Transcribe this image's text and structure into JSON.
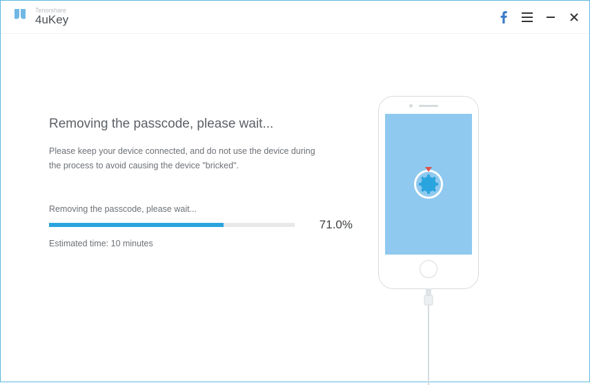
{
  "brand": {
    "company": "Tenorshare",
    "product": "4uKey"
  },
  "main": {
    "heading": "Removing the passcode, please wait...",
    "description": "Please keep your device connected, and do not use the device during the process to avoid causing the device \"bricked\"."
  },
  "progress": {
    "label": "Removing the passcode, please wait...",
    "percent_text": "71.0%",
    "percent_value": 71.0,
    "estimated_label": "Estimated time: 10 minutes"
  },
  "colors": {
    "accent": "#2aa4de",
    "window_border": "#5bb7e0",
    "phone_screen": "#8fc9ef"
  }
}
